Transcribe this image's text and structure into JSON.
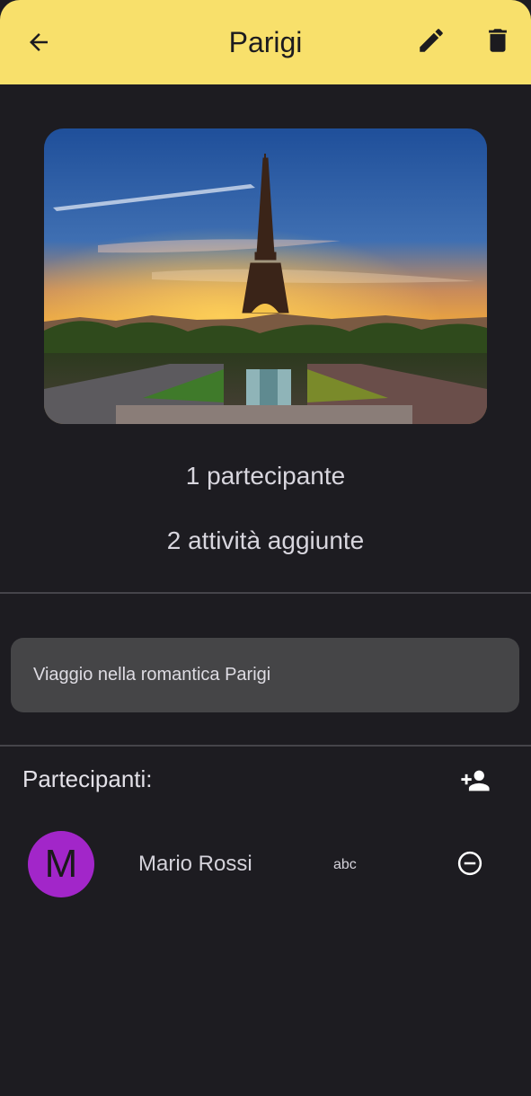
{
  "header": {
    "title": "Parigi",
    "back_icon": "arrow-back-icon",
    "edit_icon": "edit-pencil-icon",
    "delete_icon": "trash-icon",
    "background_color": "#f8e06b"
  },
  "trip": {
    "image_subject": "eiffel-tower-sunset",
    "participants_count_text": "1 partecipante",
    "activities_count_text": "2 attività aggiunte",
    "description": "Viaggio nella romantica Parigi"
  },
  "participants_section": {
    "label": "Partecipanti:",
    "add_icon": "person-add-icon",
    "items": [
      {
        "initial": "M",
        "name": "Mario Rossi",
        "extra": "abc",
        "avatar_color": "#a226c9",
        "remove_icon": "remove-circle-icon"
      }
    ]
  }
}
